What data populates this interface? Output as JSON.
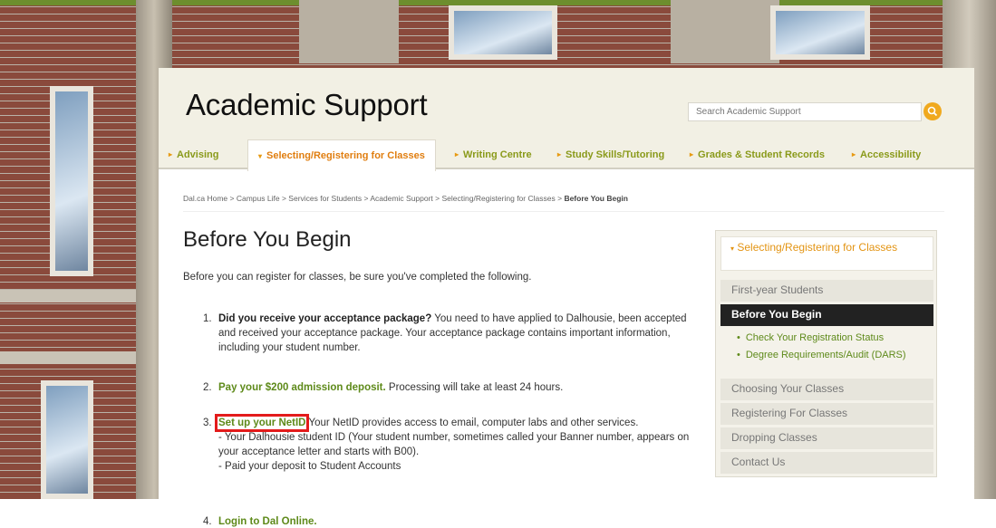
{
  "site": {
    "title": "Academic Support"
  },
  "search": {
    "placeholder": "Search Academic Support",
    "icon": "search-icon"
  },
  "nav": {
    "items": [
      {
        "label": "Advising"
      },
      {
        "label": "Selecting/Registering for Classes"
      },
      {
        "label": "Writing Centre"
      },
      {
        "label": "Study Skills/Tutoring"
      },
      {
        "label": "Grades & Student Records"
      },
      {
        "label": "Accessibility"
      }
    ],
    "active_index": 1
  },
  "breadcrumb": {
    "items": [
      "Dal.ca Home",
      "Campus Life",
      "Services for Students",
      "Academic Support",
      "Selecting/Registering for Classes"
    ],
    "separator": ">",
    "current": "Before You Begin"
  },
  "page": {
    "title": "Before You Begin",
    "intro": "Before you can register for classes, be sure you've completed the following.",
    "steps": [
      {
        "num": "1.",
        "bold": "Did you receive your acceptance package?",
        "text": " You need to have applied to Dalhousie, been accepted and received your acceptance package. Your acceptance package contains important information, including your student number."
      },
      {
        "num": "2.",
        "link": "Pay your $200 admission deposit.",
        "text": " Processing will take at least 24 hours."
      },
      {
        "num": "3.",
        "link": "Set up your NetID",
        "text": " Your NetID provides access to email, computer labs and other services.",
        "line2": " - Your Dalhousie student ID (Your student number, sometimes called your Banner number, appears on your acceptance letter and starts with B00).",
        "line3": " - Paid your deposit to Student Accounts"
      },
      {
        "num": "4.",
        "link": "Login to Dal Online."
      }
    ]
  },
  "sidebar": {
    "header": "Selecting/Registering for Classes",
    "items": [
      {
        "label": "First-year Students"
      },
      {
        "label": "Before You Begin"
      },
      {
        "label": "Check Your Registration Status"
      },
      {
        "label": "Degree Requirements/Audit (DARS)"
      },
      {
        "label": "Choosing Your Classes"
      },
      {
        "label": "Registering For Classes"
      },
      {
        "label": "Dropping Classes"
      },
      {
        "label": "Contact Us"
      }
    ]
  },
  "colors": {
    "accent_orange": "#e79a12",
    "link_green": "#5e8a1a",
    "nav_green": "#8a9a1a",
    "highlight_red": "#e31b1b",
    "header_bg": "#f2f0e4"
  }
}
